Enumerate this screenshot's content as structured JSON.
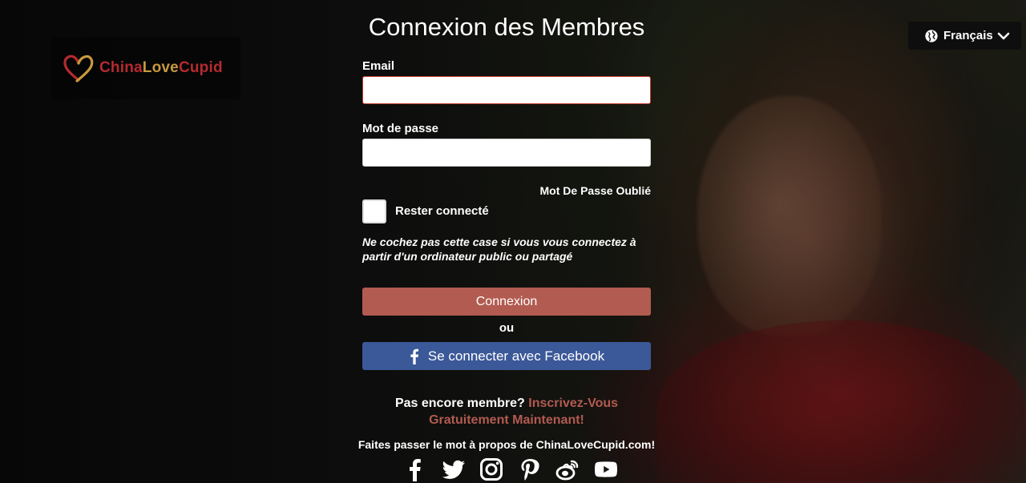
{
  "brand": {
    "name_part1": "China",
    "name_part2": "Love",
    "name_part3": "Cupid",
    "color_red": "#b52b2f",
    "color_gold": "#c79a3e",
    "logo_icon": "heart-icon"
  },
  "language": {
    "selected": "Français",
    "icon": "globe-icon",
    "chevron": "chevron-down-icon"
  },
  "form": {
    "title": "Connexion des Membres",
    "email_label": "Email",
    "email_value": "",
    "password_label": "Mot de passe",
    "password_value": "",
    "forgot_password": "Mot De Passe Oublié",
    "remember_label": "Rester connecté",
    "remember_checked": false,
    "note": "Ne cochez pas cette case si vous vous connectez à partir d'un ordinateur public ou partagé",
    "login_button": "Connexion",
    "or_text": "ou",
    "facebook_button": "Se connecter avec Facebook",
    "login_color": "#b25b50",
    "facebook_color": "#3b5898"
  },
  "signup": {
    "prompt": "Pas encore membre?",
    "link_text": "Inscrivez-Vous Gratuitement Maintenant!"
  },
  "share": {
    "text": "Faites passer le mot à propos de ChinaLoveCupid.com!",
    "icons": [
      "facebook-icon",
      "twitter-icon",
      "instagram-icon",
      "pinterest-icon",
      "weibo-icon",
      "youtube-icon"
    ]
  }
}
